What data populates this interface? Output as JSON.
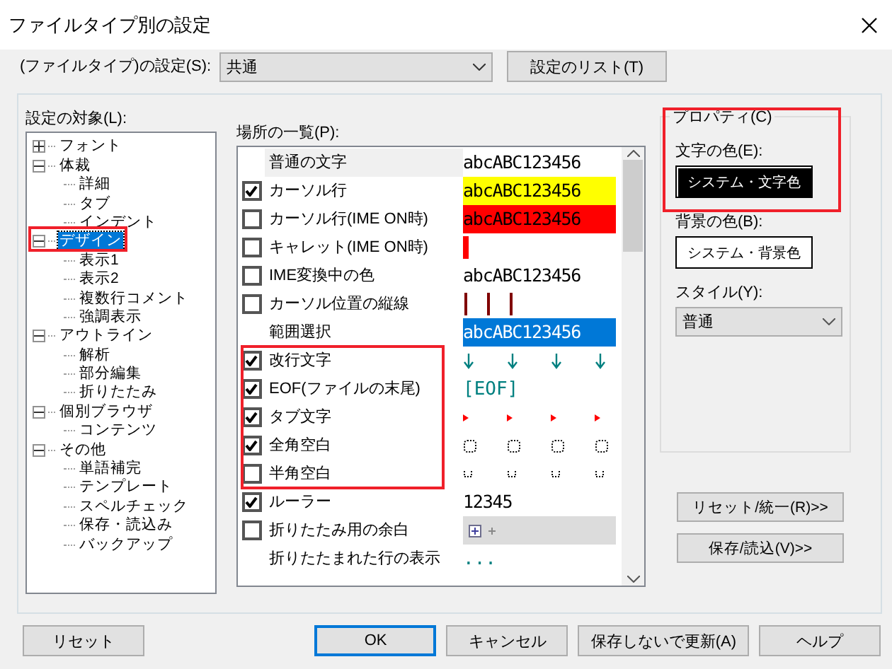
{
  "window": {
    "title": "ファイルタイプ別の設定"
  },
  "filetype": {
    "label": "(ファイルタイプ)の設定(S):",
    "value": "共通",
    "list_button": "設定のリスト(T)"
  },
  "targets": {
    "label": "設定の対象(L):",
    "items": [
      {
        "label": "フォント",
        "expanded": false,
        "selected": false
      },
      {
        "label": "体裁",
        "expanded": true,
        "selected": false,
        "children": [
          {
            "label": "詳細",
            "selected": false
          },
          {
            "label": "タブ",
            "selected": false
          },
          {
            "label": "インデント",
            "selected": false
          }
        ]
      },
      {
        "label": "デザイン",
        "expanded": true,
        "selected": true,
        "children": [
          {
            "label": "表示1",
            "selected": false
          },
          {
            "label": "表示2",
            "selected": false
          },
          {
            "label": "複数行コメント",
            "selected": false
          },
          {
            "label": "強調表示",
            "selected": false
          }
        ]
      },
      {
        "label": "アウトライン",
        "expanded": true,
        "selected": false,
        "children": [
          {
            "label": "解析",
            "selected": false
          },
          {
            "label": "部分編集",
            "selected": false
          },
          {
            "label": "折りたたみ",
            "selected": false
          }
        ]
      },
      {
        "label": "個別ブラウザ",
        "expanded": true,
        "selected": false,
        "children": [
          {
            "label": "コンテンツ",
            "selected": false
          }
        ]
      },
      {
        "label": "その他",
        "expanded": true,
        "selected": false,
        "children": [
          {
            "label": "単語補完",
            "selected": false
          },
          {
            "label": "テンプレート",
            "selected": false
          },
          {
            "label": "スペルチェック",
            "selected": false
          },
          {
            "label": "保存・読込み",
            "selected": false
          },
          {
            "label": "バックアップ",
            "selected": false
          }
        ]
      }
    ]
  },
  "places": {
    "label": "場所の一覧(P):",
    "rows": [
      {
        "label": "普通の文字",
        "selected": true,
        "kind": "text",
        "preview": "abcABC123456",
        "color": "#ffffff"
      },
      {
        "label": "カーソル行",
        "checked": true,
        "selected": false,
        "kind": "text",
        "preview": "abcABC123456",
        "color": "#ffff00"
      },
      {
        "label": "カーソル行(IME ON時)",
        "checked": false,
        "selected": false,
        "kind": "text",
        "preview": "abcABC123456",
        "color": "#ff0000"
      },
      {
        "label": "キャレット(IME ON時)",
        "checked": false,
        "selected": false,
        "kind": "caret"
      },
      {
        "label": "IME変換中の色",
        "checked": false,
        "selected": false,
        "kind": "text",
        "preview": "abcABC123456",
        "color": "#ffffff"
      },
      {
        "label": "カーソル位置の縦線",
        "checked": false,
        "selected": false,
        "kind": "vlines"
      },
      {
        "label": "範囲選択",
        "selected": false,
        "kind": "text",
        "preview": "abcABC123456",
        "color": "#0078d7"
      },
      {
        "label": "改行文字",
        "checked": true,
        "selected": false,
        "kind": "arrows"
      },
      {
        "label": "EOF(ファイルの末尾)",
        "checked": true,
        "selected": false,
        "kind": "mark",
        "preview": "[EOF]"
      },
      {
        "label": "タブ文字",
        "checked": true,
        "selected": false,
        "kind": "tabs"
      },
      {
        "label": "全角空白",
        "checked": true,
        "selected": false,
        "kind": "zenkaku"
      },
      {
        "label": "半角空白",
        "checked": false,
        "selected": false,
        "kind": "hankaku"
      },
      {
        "label": "ルーラー",
        "checked": true,
        "selected": false,
        "kind": "plain",
        "preview": "12345"
      },
      {
        "label": "折りたたみ用の余白",
        "checked": false,
        "selected": false,
        "kind": "fold"
      },
      {
        "label": "折りたたまれた行の表示",
        "selected": false,
        "kind": "mark",
        "preview": "..."
      }
    ]
  },
  "properties": {
    "title": "プロパティ(C)",
    "text_color_label": "文字の色(E):",
    "text_color_button": "システム・文字色",
    "bg_color_label": "背景の色(B):",
    "bg_color_button": "システム・背景色",
    "style_label": "スタイル(Y):",
    "style_value": "普通"
  },
  "side_buttons": [
    "リセット/統一(R)>>",
    "保存/読込(V)>>"
  ],
  "footer": {
    "reset": "リセット",
    "buttons": [
      {
        "label": "OK",
        "default": true
      },
      {
        "label": "キャンセル",
        "default": false
      },
      {
        "label": "保存しないで更新(A)",
        "default": false
      },
      {
        "label": "ヘルプ",
        "default": false
      }
    ]
  }
}
